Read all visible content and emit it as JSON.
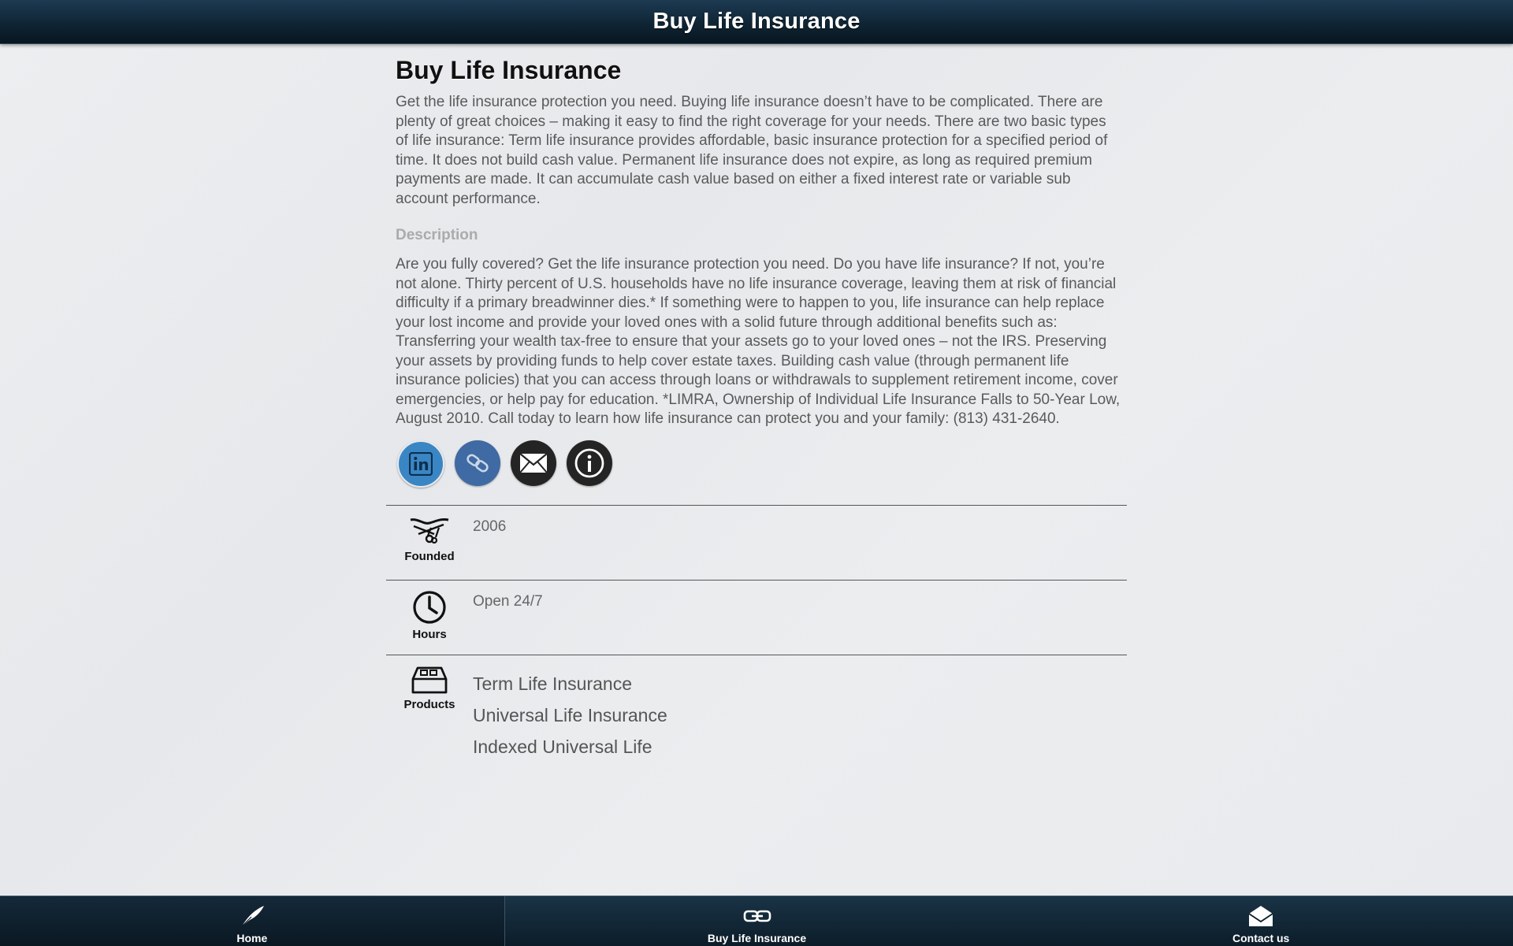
{
  "header": {
    "title": "Buy Life Insurance"
  },
  "main": {
    "title": "Buy Life Insurance",
    "intro": "Get the life insurance protection you need.  Buying life insurance doesn’t have to be complicated. There are plenty of great choices – making it easy to find the right coverage for your needs. There are two basic types of life insurance:  Term life insurance provides affordable, basic insurance protection for a specified period of time. It does not build cash value.  Permanent life insurance does not expire, as long as required premium payments are made. It can accumulate cash value based on either a fixed interest rate or variable sub account performance.",
    "description_heading": "Description",
    "description": "Are you fully covered?  Get the life insurance protection you need.  Do you have life insurance? If not, you’re not alone. Thirty percent of U.S. households have no life insurance coverage, leaving them at risk of financial difficulty if a primary breadwinner dies.*  If something were to happen to you, life insurance can help replace your lost income and provide your loved ones with a solid future through additional benefits such as: Transferring your wealth tax-free to ensure that your assets go to your loved ones – not the IRS. Preserving your assets by providing funds to help cover estate taxes. Building cash value (through permanent life insurance policies) that you can access through loans or withdrawals to supplement retirement income, cover emergencies, or help pay for education. *LIMRA, Ownership of Individual Life Insurance Falls to 50-Year Low, August 2010.  Call today to learn how life insurance can protect you and your family: (813) 431-2640.",
    "social": [
      {
        "icon": "linkedin-icon",
        "color": "#3a86c5"
      },
      {
        "icon": "link-icon",
        "color": "#3f6aa3"
      },
      {
        "icon": "email-icon",
        "color": "#242424"
      },
      {
        "icon": "info-icon",
        "color": "#242424"
      }
    ],
    "info": {
      "founded": {
        "label": "Founded",
        "value": "2006",
        "icon": "ribbon-cutting-icon"
      },
      "hours": {
        "label": "Hours",
        "value": "Open 24/7",
        "icon": "clock-icon"
      },
      "products": {
        "label": "Products",
        "icon": "products-box-icon",
        "items": [
          "Term Life Insurance",
          "Universal Life Insurance",
          "Indexed Universal Life"
        ]
      }
    }
  },
  "footer": {
    "tabs": [
      {
        "label": "Home",
        "icon": "quill-icon",
        "active": true
      },
      {
        "label": "Buy Life Insurance",
        "icon": "link-icon",
        "active": false
      },
      {
        "label": "Contact us",
        "icon": "envelope-icon",
        "active": false
      }
    ]
  },
  "colors": {
    "header_bg": "#0f2535",
    "accent_linkedin": "#3a86c5",
    "text_muted": "#5a5a5a"
  }
}
